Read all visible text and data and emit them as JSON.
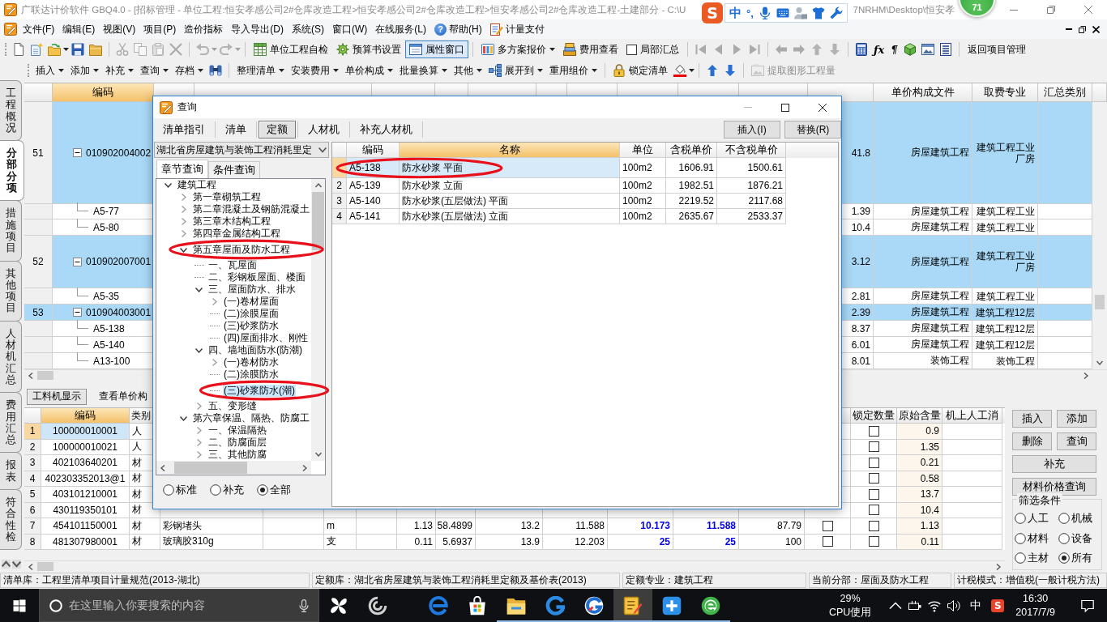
{
  "window": {
    "title": "广联达计价软件 GBQ4.0 - [招标管理 - 单位工程:恒安孝感公司2#仓库改造工程>恒安孝感公司2#仓库改造工程>恒安孝感公司2#仓库改造工程-土建部分 - C:\\U",
    "title_tail": "7NRHM\\Desktop\\恒安孝"
  },
  "ime_toolbar": {
    "logo": "S",
    "mode": "中",
    "punctuation": "°,"
  },
  "floating_badge": {
    "value": "71"
  },
  "menu": [
    {
      "kind": "text",
      "label": "文件(F)"
    },
    {
      "kind": "text",
      "label": "编辑(E)"
    },
    {
      "kind": "text",
      "label": "视图(V)"
    },
    {
      "kind": "text",
      "label": "项目(P)"
    },
    {
      "kind": "text",
      "label": "造价指标"
    },
    {
      "kind": "text",
      "label": "导入导出(D)"
    },
    {
      "kind": "text",
      "label": "系统(S)"
    },
    {
      "kind": "text",
      "label": "窗口(W)"
    },
    {
      "kind": "text",
      "label": "在线服务(L)"
    },
    {
      "kind": "help",
      "icon": "?",
      "label": "帮助(H)"
    },
    {
      "kind": "pay",
      "label": "计量支付"
    }
  ],
  "toolbar_1": [
    [
      {
        "kind": "new",
        "disabled": false
      },
      {
        "kind": "new_project",
        "disabled": false
      },
      {
        "kind": "open",
        "disabled": false
      },
      {
        "kind": "save",
        "disabled": false
      },
      {
        "kind": "folder",
        "disabled": false
      }
    ],
    [
      {
        "kind": "cut",
        "disabled": true
      },
      {
        "kind": "copy",
        "disabled": true
      },
      {
        "kind": "paste",
        "disabled": true
      },
      {
        "kind": "delete",
        "disabled": true
      }
    ],
    [
      {
        "kind": "undo",
        "disabled": true
      },
      {
        "kind": "redo",
        "disabled": true
      }
    ],
    [
      {
        "kind": "check",
        "label": "单位工程自检",
        "disabled": false,
        "pressed": false
      },
      {
        "kind": "settings",
        "label": "预算书设置",
        "disabled": false,
        "pressed": false
      },
      {
        "kind": "window",
        "label": "属性窗口",
        "disabled": false,
        "pressed": true
      }
    ],
    [
      {
        "kind": "quote",
        "label": "多方案报价",
        "disabled": false,
        "pressed": false
      },
      {
        "kind": "cost",
        "label": "费用查看",
        "disabled": false,
        "pressed": false
      },
      {
        "kind": "checkbox",
        "label": "局部汇总",
        "checked": false
      }
    ],
    [
      {
        "kind": "first",
        "disabled": true
      },
      {
        "kind": "prev",
        "disabled": true
      },
      {
        "kind": "next",
        "disabled": true
      },
      {
        "kind": "last",
        "disabled": true
      }
    ],
    [
      {
        "kind": "left",
        "disabled": true
      },
      {
        "kind": "right",
        "disabled": true
      },
      {
        "kind": "up",
        "disabled": true
      },
      {
        "kind": "down",
        "disabled": true
      }
    ],
    [
      {
        "kind": "calc",
        "disabled": false
      },
      {
        "kind": "glyph",
        "label": "ƒx",
        "disabled": false
      },
      {
        "kind": "glyph",
        "label": "¶",
        "disabled": false
      },
      {
        "kind": "cube",
        "disabled": false
      },
      {
        "kind": "picture",
        "disabled": false
      },
      {
        "kind": "list",
        "disabled": false
      }
    ],
    [
      {
        "kind": "text",
        "label": "返回项目管理",
        "disabled": false,
        "pressed": false
      }
    ]
  ],
  "toolbar_2": [
    [
      {
        "kind": "menu",
        "label": "插入",
        "disabled": false
      },
      {
        "kind": "menu",
        "label": "添加",
        "disabled": false
      },
      {
        "kind": "menu",
        "label": "补充",
        "disabled": false
      },
      {
        "kind": "menu",
        "label": "查询",
        "disabled": false
      },
      {
        "kind": "menu",
        "label": "存档",
        "disabled": false
      },
      {
        "kind": "find",
        "disabled": false
      }
    ],
    [
      {
        "kind": "menu",
        "label": "整理清单",
        "disabled": false
      },
      {
        "kind": "menu",
        "label": "安装费用",
        "disabled": false
      },
      {
        "kind": "menu",
        "label": "单价构成",
        "disabled": false
      },
      {
        "kind": "menu",
        "label": "批量换算",
        "disabled": false
      },
      {
        "kind": "menu",
        "label": "其他",
        "disabled": false
      },
      {
        "kind": "expand",
        "label": "展开到",
        "disabled": false
      },
      {
        "kind": "menu",
        "label": "重用组价",
        "disabled": false
      }
    ],
    [
      {
        "kind": "lock",
        "label": "锁定清单",
        "disabled": false
      },
      {
        "kind": "paint",
        "disabled": false
      }
    ],
    [
      {
        "kind": "up",
        "disabled": false
      },
      {
        "kind": "down",
        "disabled": false
      }
    ],
    [
      {
        "kind": "extract",
        "label": "提取图形工程量",
        "disabled": true
      }
    ]
  ],
  "vertical_tabs": [
    {
      "label": "工程概况",
      "selected": false
    },
    {
      "label": "分部分项",
      "selected": true
    },
    {
      "label": "措施项目",
      "selected": false
    },
    {
      "label": "其他项目",
      "selected": false
    },
    {
      "label": "人材机汇总",
      "selected": false
    },
    {
      "label": "费用汇总",
      "selected": false
    },
    {
      "label": "报表",
      "selected": false
    },
    {
      "label": "符合性检",
      "selected": false
    }
  ],
  "grid": {
    "headers": [
      {
        "label": "编码",
        "selected": true
      },
      {
        "label": "单价构成文件",
        "selected": false
      },
      {
        "label": "取费专业",
        "selected": false
      },
      {
        "label": "汇总类别",
        "selected": false
      }
    ],
    "rows": [
      {
        "kind": "item",
        "number": "51",
        "code": "010902004002",
        "expanded": true,
        "selected": false,
        "column_13": "41.8",
        "price_file": "房屋建筑工程",
        "fee_type": "建筑工程工业厂房"
      },
      {
        "kind": "quota",
        "code": "A5-77",
        "selected": false,
        "column_13": "1.39",
        "price_file": "房屋建筑工程",
        "fee_type": "建筑工程工业"
      },
      {
        "kind": "quota",
        "code": "A5-80",
        "selected": false,
        "column_13": "10.4",
        "price_file": "房屋建筑工程",
        "fee_type": "建筑工程工业"
      },
      {
        "kind": "item",
        "number": "52",
        "code": "010902007001",
        "expanded": true,
        "selected": false,
        "column_13": "3.12",
        "price_file": "房屋建筑工程",
        "fee_type": "建筑工程工业厂房"
      },
      {
        "kind": "quota",
        "code": "A5-35",
        "selected": false,
        "column_13": "2.81",
        "price_file": "房屋建筑工程",
        "fee_type": "建筑工程工业"
      },
      {
        "kind": "item",
        "number": "53",
        "code": "010904003001",
        "expanded": true,
        "selected": true,
        "column_13": "2.39",
        "price_file": "房屋建筑工程",
        "fee_type": "建筑工程12层"
      },
      {
        "kind": "quota",
        "code": "A5-138",
        "selected": false,
        "column_13": "8.37",
        "price_file": "房屋建筑工程",
        "fee_type": "建筑工程12层"
      },
      {
        "kind": "quota",
        "code": "A5-140",
        "selected": false,
        "column_13": "6.01",
        "price_file": "房屋建筑工程",
        "fee_type": "建筑工程12层"
      },
      {
        "kind": "quota",
        "code": "A13-100",
        "selected": false,
        "column_13": "8.01",
        "price_file": "装饰工程",
        "fee_type": "装饰工程"
      }
    ]
  },
  "lower_panel": {
    "tabs": [
      {
        "label": "工料机显示",
        "selected": true
      },
      {
        "label": "查看单价构",
        "selected": false
      }
    ],
    "table": {
      "headers": [
        {
          "label": "编码",
          "selected": true
        },
        {
          "label": "类别",
          "selected": false
        },
        {
          "label": "锁定数量",
          "selected": false
        },
        {
          "label": "原始含量",
          "selected": false
        },
        {
          "label": "机上人工消",
          "selected": false
        }
      ],
      "rows": [
        {
          "number": "1",
          "code": "100000010001",
          "category": "人",
          "lock_quantity": false,
          "original_content": "0.9",
          "selected": true
        },
        {
          "number": "2",
          "code": "100000010021",
          "category": "人",
          "lock_quantity": false,
          "original_content": "1.35",
          "selected": false
        },
        {
          "number": "3",
          "code": "402103640201",
          "category": "材",
          "lock_quantity": false,
          "original_content": "0.21",
          "selected": false
        },
        {
          "number": "4",
          "code": "402303352013@1",
          "category": "材",
          "lock_quantity": false,
          "original_content": "0.58",
          "selected": false
        },
        {
          "number": "5",
          "code": "403101210001",
          "category": "材",
          "lock_quantity": false,
          "original_content": "13.7",
          "selected": false
        },
        {
          "number": "6",
          "code": "430119350101",
          "category": "材",
          "lock_quantity": false,
          "original_content": "10.4",
          "selected": false
        },
        {
          "number": "7",
          "code": "454101150001",
          "category": "材",
          "column_4": "彩钢堵头",
          "column_6": "m",
          "column_8": "1.13",
          "column_9": "58.4899",
          "column_10": "13.2",
          "column_11": "11.588",
          "column_12": "10.173",
          "column_13": "11.588",
          "column_14": "87.79",
          "column_15": false,
          "lock_quantity": false,
          "original_content": "1.13",
          "selected": false
        },
        {
          "number": "8",
          "code": "481307980001",
          "category": "材",
          "column_4": "玻璃胶310g",
          "column_6": "支",
          "column_8": "0.11",
          "column_9": "5.6937",
          "column_10": "13.9",
          "column_11": "12.203",
          "column_12": "25",
          "column_13": "25",
          "column_14": "100",
          "column_15": false,
          "lock_quantity": false,
          "original_content": "0.11",
          "selected": false
        }
      ]
    },
    "buttons": [
      "插入",
      "添加",
      "删除",
      "查询",
      "补充",
      "材料价格查询"
    ],
    "filter": {
      "title": "筛选条件",
      "options": [
        {
          "label": "人工",
          "selected": false
        },
        {
          "label": "机械",
          "selected": false
        },
        {
          "label": "材料",
          "selected": false
        },
        {
          "label": "设备",
          "selected": false
        },
        {
          "label": "主材",
          "selected": false
        },
        {
          "label": "所有",
          "selected": true
        }
      ]
    }
  },
  "status_bar": [
    "清单库：工程里清单项目计量规范(2013-湖北)",
    "定额库：湖北省房屋建筑与装饰工程消耗里定额及基价表(2013)",
    "定额专业：建筑工程",
    "当前分部：屋面及防水工程",
    "计税模式：增值税(一般计税方法)"
  ],
  "dialog": {
    "title": "查询",
    "tabs": [
      {
        "label": "清单指引",
        "selected": false
      },
      {
        "label": "清单",
        "selected": false
      },
      {
        "label": "定额",
        "selected": true
      },
      {
        "label": "人材机",
        "selected": false
      },
      {
        "label": "补充人材机",
        "selected": false
      }
    ],
    "actions": [
      "插入(I)",
      "替换(R)"
    ],
    "library": "湖北省房屋建筑与装饰工程消耗里定",
    "search_tabs": [
      {
        "label": "章节查询",
        "selected": true
      },
      {
        "label": "条件查询",
        "selected": false
      }
    ],
    "tree": [
      {
        "label": "建筑工程",
        "kind": "branch",
        "expanded": true,
        "selected": false,
        "circled": false,
        "children": [
          {
            "label": "第一章砌筑工程",
            "kind": "branch",
            "expanded": false,
            "selected": false,
            "circled": false
          },
          {
            "label": "第二章混凝土及钢筋混凝土",
            "kind": "branch",
            "expanded": false,
            "selected": false,
            "circled": false
          },
          {
            "label": "第三章木结构工程",
            "kind": "branch",
            "expanded": false,
            "selected": false,
            "circled": false
          },
          {
            "label": "第四章金属结构工程",
            "kind": "branch",
            "expanded": false,
            "selected": false,
            "circled": false
          },
          {
            "label": "第五章屋面及防水工程",
            "kind": "branch",
            "expanded": true,
            "selected": false,
            "circled": true,
            "children": [
              {
                "label": "一、瓦屋面",
                "kind": "leaf",
                "selected": false,
                "circled": false
              },
              {
                "label": "二、彩钢板屋面、楼面",
                "kind": "leaf",
                "selected": false,
                "circled": false
              },
              {
                "label": "三、屋面防水、排水",
                "kind": "branch",
                "expanded": true,
                "selected": false,
                "circled": false,
                "children": [
                  {
                    "label": "(一)卷材屋面",
                    "kind": "branch",
                    "expanded": false,
                    "selected": false,
                    "circled": false
                  },
                  {
                    "label": "(二)涂膜屋面",
                    "kind": "leaf",
                    "selected": false,
                    "circled": false
                  },
                  {
                    "label": "(三)砂浆防水",
                    "kind": "leaf",
                    "selected": false,
                    "circled": false
                  },
                  {
                    "label": "(四)屋面排水、刚性",
                    "kind": "leaf",
                    "selected": false,
                    "circled": false
                  }
                ]
              },
              {
                "label": "四、墙地面防水(防潮)",
                "kind": "branch",
                "expanded": true,
                "selected": false,
                "circled": false,
                "children": [
                  {
                    "label": "(一)卷材防水",
                    "kind": "branch",
                    "expanded": false,
                    "selected": false,
                    "circled": false
                  },
                  {
                    "label": "(二)涂膜防水",
                    "kind": "leaf",
                    "selected": false,
                    "circled": false
                  },
                  {
                    "label": "(三)砂浆防水(潮)",
                    "kind": "leaf",
                    "selected": true,
                    "circled": true
                  }
                ]
              },
              {
                "label": "五、变形缝",
                "kind": "branch",
                "expanded": false,
                "selected": false,
                "circled": false
              }
            ]
          },
          {
            "label": "第六章保温、隔热、防腐工",
            "kind": "branch",
            "expanded": true,
            "selected": false,
            "circled": false,
            "children": [
              {
                "label": "一、保温隔热",
                "kind": "branch",
                "expanded": false,
                "selected": false,
                "circled": false
              },
              {
                "label": "二、防腐面层",
                "kind": "branch",
                "expanded": false,
                "selected": false,
                "circled": false
              },
              {
                "label": "三、其他防腐",
                "kind": "branch",
                "expanded": false,
                "selected": false,
                "circled": false
              }
            ]
          }
        ]
      }
    ],
    "library_filter": [
      {
        "label": "标准",
        "selected": false
      },
      {
        "label": "补充",
        "selected": false
      },
      {
        "label": "全部",
        "selected": true
      }
    ],
    "results": {
      "headers": [
        {
          "label": "编码",
          "selected": false
        },
        {
          "label": "名称",
          "selected": true
        },
        {
          "label": "单位",
          "selected": false
        },
        {
          "label": "含税单价",
          "selected": false
        },
        {
          "label": "不含税单价",
          "selected": false
        }
      ],
      "rows": [
        {
          "code": "A5-138",
          "name": "防水砂浆 平面",
          "unit": "100m2",
          "price_with_tax": "1606.91",
          "price_without_tax": "1500.61",
          "selected": true,
          "circled": true
        },
        {
          "number": "2",
          "code": "A5-139",
          "name": "防水砂浆 立面",
          "unit": "100m2",
          "price_with_tax": "1982.51",
          "price_without_tax": "1876.21",
          "selected": false,
          "circled": false
        },
        {
          "number": "3",
          "code": "A5-140",
          "name": "防水砂浆(五层做法) 平面",
          "unit": "100m2",
          "price_with_tax": "2219.52",
          "price_without_tax": "2117.68",
          "selected": false,
          "circled": false
        },
        {
          "number": "4",
          "code": "A5-141",
          "name": "防水砂浆(五层做法) 立面",
          "unit": "100m2",
          "price_with_tax": "2635.67",
          "price_without_tax": "2533.37",
          "selected": false,
          "circled": false
        }
      ]
    }
  },
  "taskbar": {
    "search": {
      "placeholder": "在这里输入你要搜索的内容"
    },
    "apps": [
      {
        "kind": "pinwheel",
        "running": false,
        "active": false
      },
      {
        "kind": "swirl",
        "running": false,
        "active": false
      },
      {
        "kind": "ring",
        "running": false,
        "active": false
      },
      {
        "kind": "bag",
        "running": false,
        "active": false
      },
      {
        "kind": "folder",
        "running": true,
        "active": false
      },
      {
        "kind": "gswirl",
        "running": true,
        "active": false
      },
      {
        "kind": "gcolor",
        "running": true,
        "active": false
      },
      {
        "kind": "notepad",
        "running": true,
        "active": true
      },
      {
        "kind": "plus",
        "running": true,
        "active": false
      },
      {
        "kind": "globe",
        "running": true,
        "active": false
      }
    ],
    "cpu": {
      "value": "29%",
      "label": "CPU使用"
    },
    "input_mode": "中",
    "tray_logo": "S",
    "time": "16:30",
    "date": "2017/7/9"
  }
}
